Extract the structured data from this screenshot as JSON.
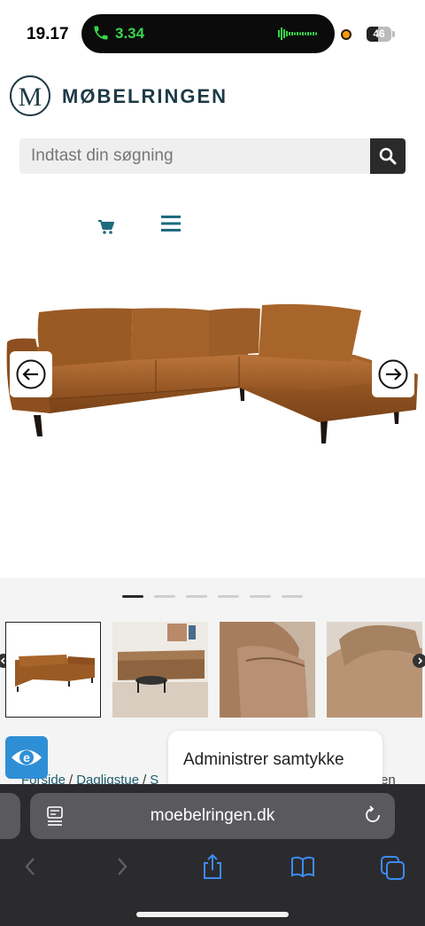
{
  "status_bar": {
    "time": "19.17",
    "call_duration": "3.34",
    "battery": "46",
    "battery_level": 0.46,
    "call_color": "#38d64b"
  },
  "brand": {
    "logo_letter": "M",
    "name": "MØBELRINGEN",
    "color": "#1e3a46"
  },
  "search": {
    "placeholder": "Indtast din søgning",
    "button_icon": "search-icon"
  },
  "nav": {
    "cart_icon": "cart-icon",
    "menu_icon": "hamburger-menu-icon",
    "accent": "#1e6b7d"
  },
  "gallery": {
    "image": "sofa-main-image",
    "slides_total": 6,
    "active_slide": 1,
    "thumbnails": [
      {
        "name": "thumb-sofa-studio",
        "selected": true
      },
      {
        "name": "thumb-sofa-room",
        "selected": false
      },
      {
        "name": "thumb-cushion-detail",
        "selected": false
      },
      {
        "name": "thumb-back-detail",
        "selected": false
      }
    ]
  },
  "breadcrumb": {
    "items": [
      "Forside",
      "Dagligstue",
      "S"
    ],
    "tail": "en"
  },
  "consent": {
    "label": "Administrer samtykke"
  },
  "browser": {
    "url": "moebelringen.dk",
    "toolbar": [
      "back-icon",
      "forward-icon",
      "share-icon",
      "bookmarks-icon",
      "tabs-icon"
    ]
  }
}
